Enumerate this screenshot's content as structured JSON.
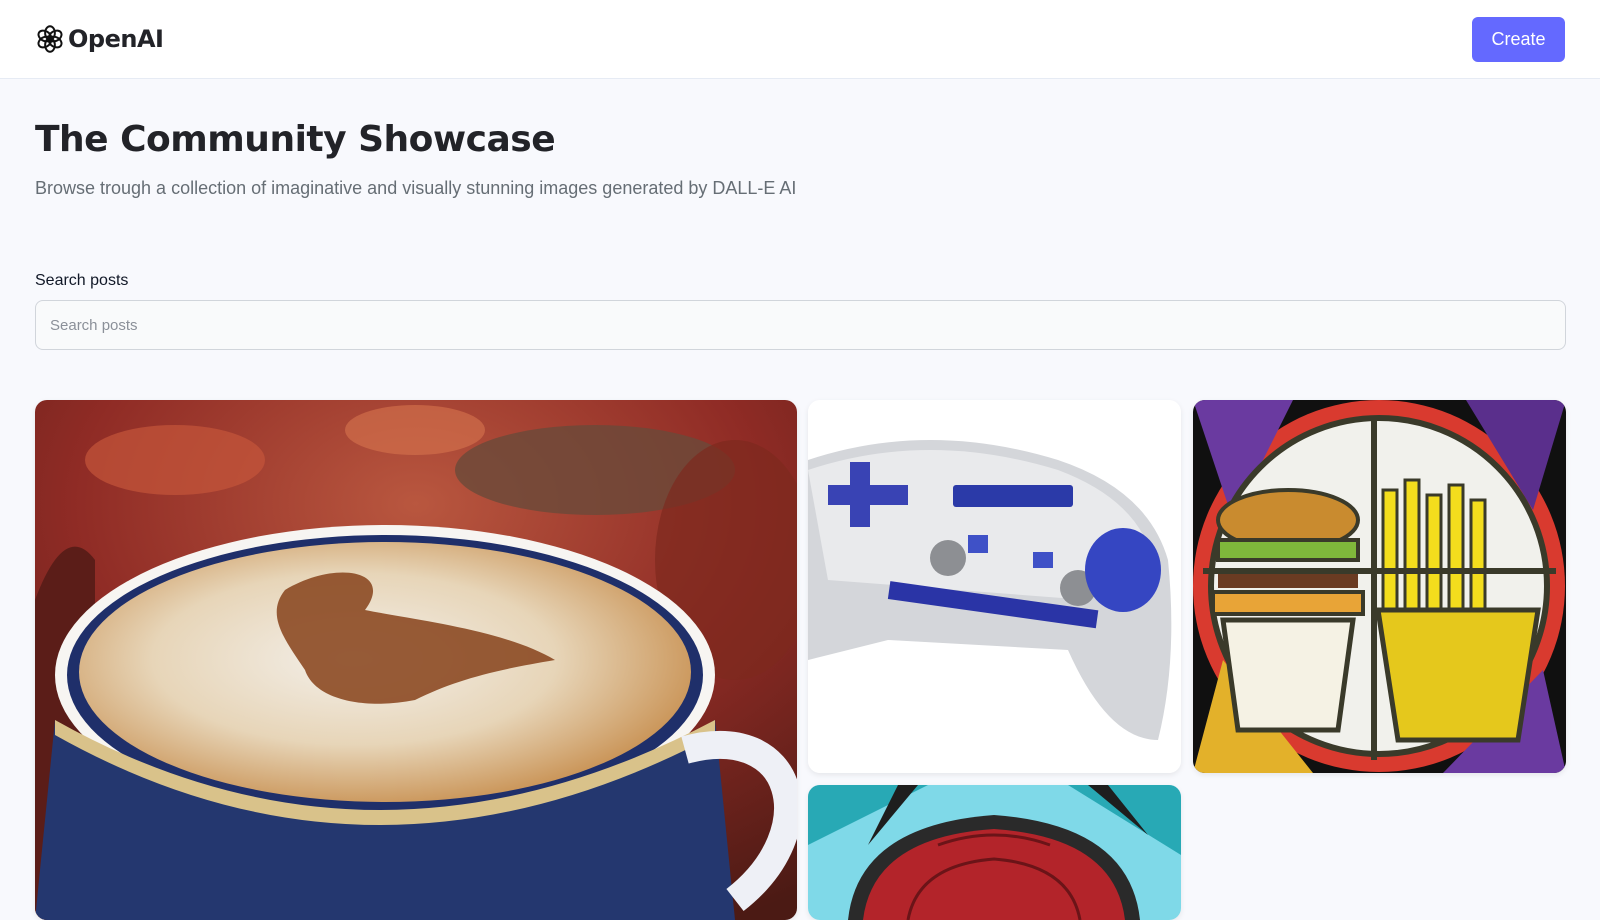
{
  "header": {
    "logo_text": "OpenAI",
    "logo_icon": "openai-logo-icon",
    "create_label": "Create"
  },
  "hero": {
    "title": "The Community Showcase",
    "subtitle": "Browse trough a collection of imaginative and visually stunning images generated by DALL-E AI"
  },
  "search": {
    "label": "Search posts",
    "placeholder": "Search posts",
    "value": ""
  },
  "gallery": {
    "items": [
      {
        "name": "cappuccino-image",
        "alt": "Cup of cappuccino with cinnamon"
      },
      {
        "name": "game-controller-image",
        "alt": "Silver game controller with blue buttons"
      },
      {
        "name": "stained-glass-image",
        "alt": "Stained glass burger and fries"
      },
      {
        "name": "astronaut-comic-image",
        "alt": "Comic style astronaut helmet"
      }
    ]
  },
  "colors": {
    "accent": "#6469ff",
    "background": "#f8f9fd",
    "title": "#222328",
    "subtitle": "#666e75"
  }
}
